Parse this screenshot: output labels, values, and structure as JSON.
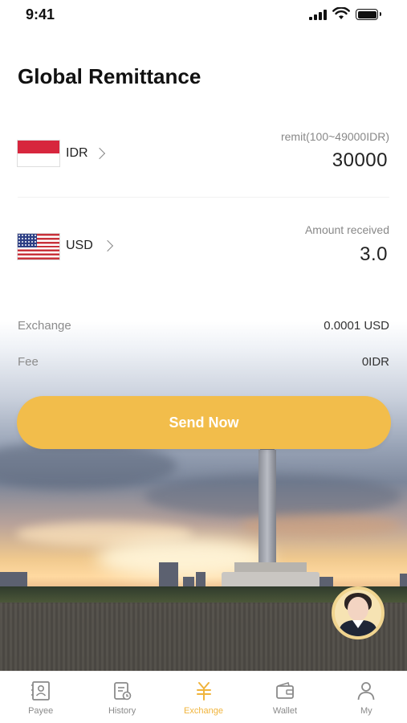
{
  "status_bar": {
    "time": "9:41"
  },
  "title": "Global Remittance",
  "send": {
    "currency": "IDR",
    "hint": "remit(100~49000IDR)",
    "amount": "30000"
  },
  "receive": {
    "currency": "USD",
    "hint": "Amount received",
    "amount": "3.0"
  },
  "exchange": {
    "label": "Exchange",
    "value": "0.0001 USD"
  },
  "fee": {
    "label": "Fee",
    "value": "0IDR"
  },
  "send_button": "Send Now",
  "tabs": [
    {
      "label": "Payee",
      "icon": "payee-icon"
    },
    {
      "label": "History",
      "icon": "history-icon"
    },
    {
      "label": "Exchange",
      "icon": "yuan-icon",
      "active": true
    },
    {
      "label": "Wallet",
      "icon": "wallet-icon"
    },
    {
      "label": "My",
      "icon": "person-icon"
    }
  ],
  "colors": {
    "accent": "#f2bd4b",
    "tab_active": "#f0b43c"
  }
}
